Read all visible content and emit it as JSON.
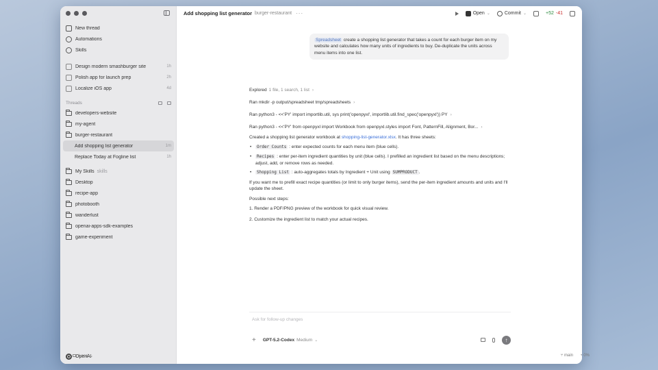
{
  "topbar": {
    "title": "Add shopping list generator",
    "project": "burger-restaurant",
    "more": "···",
    "open_label": "Open",
    "commit_label": "Commit",
    "diff_added": "+52",
    "diff_removed": "-41"
  },
  "sidebar": {
    "nav": [
      {
        "label": "New thread",
        "icon": "new-thread-icon"
      },
      {
        "label": "Automations",
        "icon": "clock-icon"
      },
      {
        "label": "Skills",
        "icon": "skills-icon"
      }
    ],
    "recent": [
      {
        "label": "Design modern smashburger site",
        "meta": "1h"
      },
      {
        "label": "Polish app for launch prep",
        "meta": "2h"
      },
      {
        "label": "Localize iOS app",
        "meta": "4d"
      }
    ],
    "threads_header": "Threads",
    "threads": [
      {
        "label": "developers-website"
      },
      {
        "label": "my-agent"
      },
      {
        "label": "burger-restaurant"
      }
    ],
    "sub_threads": [
      {
        "label": "Add shopping list generator",
        "meta": "1m"
      },
      {
        "label": "Replace Today at Fogline list",
        "meta": "1h"
      }
    ],
    "more_threads": [
      {
        "label": "My Skills",
        "muted": "skills"
      },
      {
        "label": "Desktop"
      },
      {
        "label": "recipe-app"
      },
      {
        "label": "photobooth"
      },
      {
        "label": "wanderlust"
      },
      {
        "label": "openai-apps-sdk-examples"
      },
      {
        "label": "game-experiment"
      }
    ],
    "footer_label": "OpenAI"
  },
  "user_message": {
    "chip": "Spreadsheet",
    "text": "create a shopping list generator that takes a count for each burger item on my website and calculates how many units of ingredients to buy. De-duplicate the units across menu items into one list."
  },
  "assistant": {
    "explored": "Explored",
    "explored_detail": "1 file, 1 search, 1 list",
    "commands": [
      "Ran mkdir -p output/spreadsheet tmp/spreadsheets",
      "Ran python3 - <<'PY' import importlib.util, sys print('openpyxl', importlib.util.find_spec('openpyxl')) PY",
      "Ran python3 - <<'PY' from openpyxl import Workbook from openpyxl.styles import Font, PatternFill, Alignment, Bor..."
    ],
    "created_prefix": "Created a shopping list generator workbook at",
    "created_link": "shopping-list-generator.xlsx",
    "created_suffix": ". It has three sheets:",
    "bullets": [
      {
        "code": "Order Counts",
        "text": ": enter expected counts for each menu item (blue cells)."
      },
      {
        "code": "Recipes",
        "text": ": enter per-item ingredient quantities by unit (blue cells). I prefilled an ingredient list based on the menu descriptions; adjust, add, or remove rows as needed."
      },
      {
        "code": "Shopping List",
        "text": ": auto-aggregates totals by Ingredient + Unit using",
        "code2": "SUMPRODUCT",
        "text2": "."
      }
    ],
    "followup": "If you want me to prefill exact recipe quantities (or limit to only burger items), send the per-item ingredient amounts and units and I'll update the sheet.",
    "next_steps_label": "Possible next steps:",
    "next_steps": [
      "1. Render a PDF/PNG preview of the workbook for quick visual review.",
      "2. Customize the ingredient list to match your actual recipes."
    ]
  },
  "composer": {
    "placeholder": "Ask for follow-up changes",
    "plus": "+",
    "model": "GPT-5.2-Codex",
    "effort": "Medium",
    "send": "↑"
  },
  "statusbar": {
    "env": "Local",
    "branch": "main",
    "context": "0%"
  }
}
